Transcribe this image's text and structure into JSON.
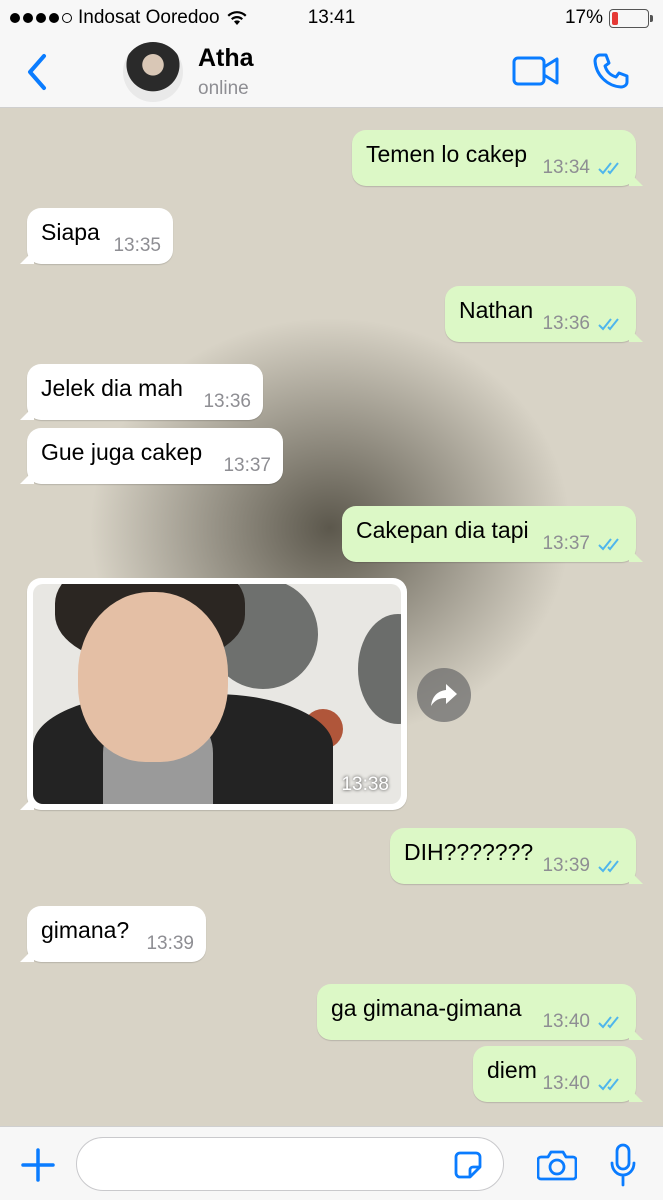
{
  "status_bar": {
    "carrier": "Indosat Ooredoo",
    "time": "13:41",
    "battery_percent": "17%",
    "battery_level": 0.17
  },
  "header": {
    "contact_name": "Atha",
    "contact_status": "online"
  },
  "messages": [
    {
      "direction": "out",
      "text": "Temen lo cakep",
      "time": "13:34",
      "read": true
    },
    {
      "direction": "in",
      "text": "Siapa",
      "time": "13:35"
    },
    {
      "direction": "out",
      "text": "Nathan",
      "time": "13:36",
      "read": true
    },
    {
      "direction": "in",
      "text": "Jelek dia mah",
      "time": "13:36"
    },
    {
      "direction": "in",
      "text": "Gue juga cakep",
      "time": "13:37"
    },
    {
      "direction": "out",
      "text": "Cakepan dia tapi",
      "time": "13:37",
      "read": true
    },
    {
      "direction": "in",
      "type": "image",
      "time": "13:38"
    },
    {
      "direction": "out",
      "text": "DIH???????",
      "time": "13:39",
      "read": true
    },
    {
      "direction": "in",
      "text": "gimana?",
      "time": "13:39"
    },
    {
      "direction": "out",
      "text": "ga gimana-gimana",
      "time": "13:40",
      "read": true
    },
    {
      "direction": "out",
      "text": "diem",
      "time": "13:40",
      "read": true
    }
  ],
  "input": {
    "value": "",
    "placeholder": ""
  },
  "colors": {
    "accent": "#0a7cff",
    "outgoing_bubble": "#dcf8c6",
    "incoming_bubble": "#ffffff",
    "read_ticks": "#4fb6ec",
    "chat_background": "#d8d3c6"
  },
  "icons": [
    "back-chevron-icon",
    "video-camera-icon",
    "phone-icon",
    "forward-icon",
    "plus-icon",
    "sticker-icon",
    "camera-icon",
    "microphone-icon",
    "wifi-icon",
    "battery-icon"
  ]
}
